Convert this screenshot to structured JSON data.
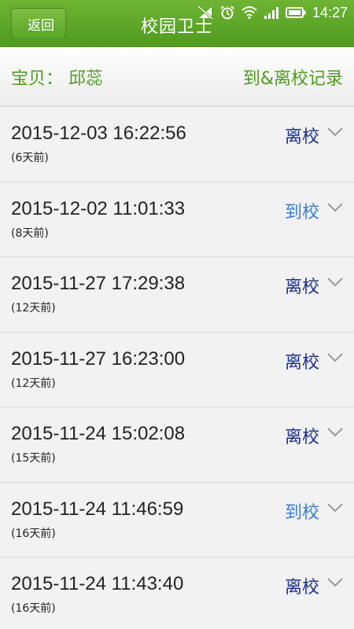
{
  "statusbar": {
    "time": "14:27"
  },
  "header": {
    "back_label": "返回",
    "title": "校园卫士"
  },
  "subheader": {
    "child_label": "宝贝： 邱蕊",
    "records_label": "到&离校记录"
  },
  "colors": {
    "leave": "#1c2f8a",
    "arrive": "#3a7fd0",
    "brand": "#5aa526"
  },
  "records": [
    {
      "timestamp": "2015-12-03 16:22:56",
      "ago": "(6天前)",
      "status": "离校",
      "type": "leave"
    },
    {
      "timestamp": "2015-12-02 11:01:33",
      "ago": "(8天前)",
      "status": "到校",
      "type": "arrive"
    },
    {
      "timestamp": "2015-11-27 17:29:38",
      "ago": "(12天前)",
      "status": "离校",
      "type": "leave"
    },
    {
      "timestamp": "2015-11-27 16:23:00",
      "ago": "(12天前)",
      "status": "离校",
      "type": "leave"
    },
    {
      "timestamp": "2015-11-24 15:02:08",
      "ago": "(15天前)",
      "status": "离校",
      "type": "leave"
    },
    {
      "timestamp": "2015-11-24 11:46:59",
      "ago": "(16天前)",
      "status": "到校",
      "type": "arrive"
    },
    {
      "timestamp": "2015-11-24 11:43:40",
      "ago": "(16天前)",
      "status": "离校",
      "type": "leave"
    }
  ]
}
